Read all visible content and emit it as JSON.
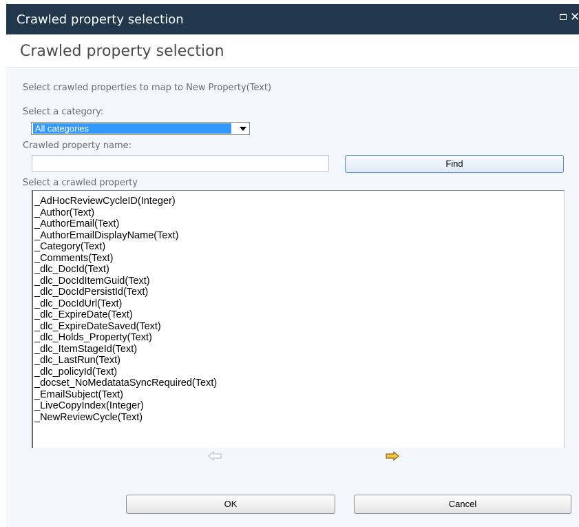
{
  "window": {
    "title": "Crawled property selection",
    "maximize_icon": "maximize-icon",
    "close_icon": "close-icon",
    "close_glyph": "✕"
  },
  "page": {
    "heading": "Crawled property selection",
    "instructions": "Select crawled properties to map to New Property(Text)"
  },
  "category": {
    "label": "Select a category:",
    "selected": "All categories"
  },
  "name_search": {
    "label": "Crawled property name:",
    "value": "",
    "find_label": "Find"
  },
  "property_list": {
    "label": "Select a crawled property",
    "items": [
      "_AdHocReviewCycleID(Integer)",
      "_Author(Text)",
      "_AuthorEmail(Text)",
      "_AuthorEmailDisplayName(Text)",
      "_Category(Text)",
      "_Comments(Text)",
      "_dlc_DocId(Text)",
      "_dlc_DocIdItemGuid(Text)",
      "_dlc_DocIdPersistId(Text)",
      "_dlc_DocIdUrl(Text)",
      "_dlc_ExpireDate(Text)",
      "_dlc_ExpireDateSaved(Text)",
      "_dlc_Holds_Property(Text)",
      "_dlc_ItemStageId(Text)",
      "_dlc_LastRun(Text)",
      "_dlc_policyId(Text)",
      "_docset_NoMedatataSyncRequired(Text)",
      "_EmailSubject(Text)",
      "_LiveCopyIndex(Integer)",
      "_NewReviewCycle(Text)"
    ]
  },
  "move_buttons": {
    "left_icon": "arrow-left-icon",
    "right_icon": "arrow-right-icon",
    "left_enabled": false,
    "right_enabled": true
  },
  "footer": {
    "ok_label": "OK",
    "cancel_label": "Cancel"
  },
  "colors": {
    "titlebar": "#21374c",
    "body_bg": "#f4f7fb",
    "selection": "#3399ff",
    "arrow_active": "#f5a623",
    "arrow_disabled": "#b8c4cf"
  }
}
